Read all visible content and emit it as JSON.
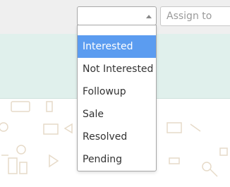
{
  "toolbar": {
    "status_select": {
      "value": "",
      "options": [
        {
          "label": "Interested",
          "highlighted": true
        },
        {
          "label": "Not Interested",
          "highlighted": false
        },
        {
          "label": "Followup",
          "highlighted": false
        },
        {
          "label": "Sale",
          "highlighted": false
        },
        {
          "label": "Resolved",
          "highlighted": false
        },
        {
          "label": "Pending",
          "highlighted": false
        }
      ]
    },
    "assign_input": {
      "placeholder": "Assign to"
    }
  },
  "colors": {
    "highlight": "#5b9cf0",
    "band": "#e0f0ec",
    "topbar": "#efefef"
  }
}
